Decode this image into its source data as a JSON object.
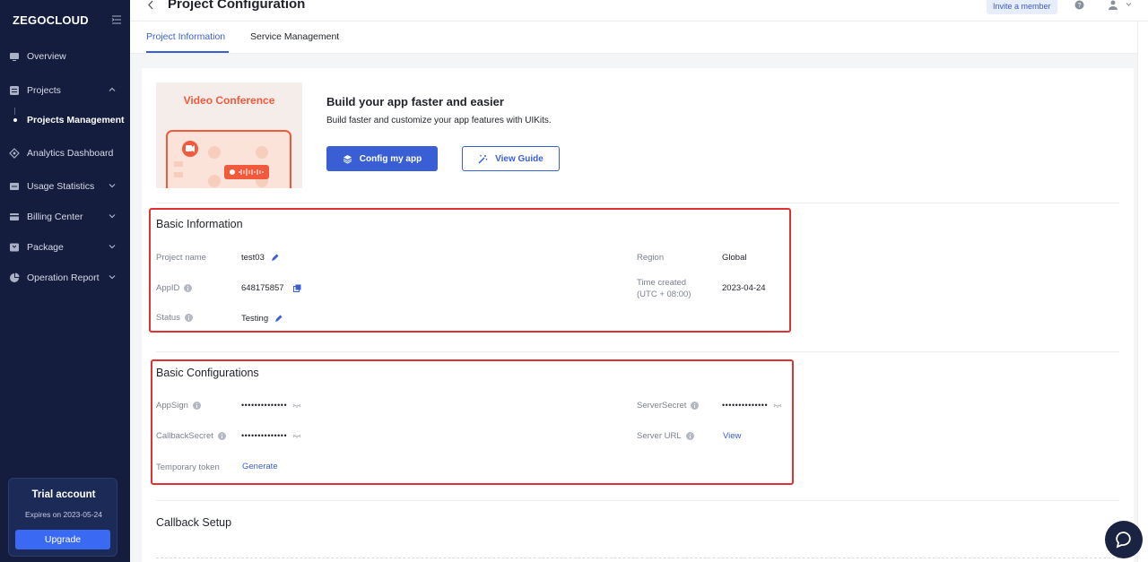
{
  "sidebar": {
    "logo": "ZEGOCLOUD",
    "items": [
      {
        "label": "Overview"
      },
      {
        "label": "Projects"
      },
      {
        "label": "Projects Management"
      },
      {
        "label": "Analytics Dashboard"
      },
      {
        "label": "Usage Statistics"
      },
      {
        "label": "Billing Center"
      },
      {
        "label": "Package"
      },
      {
        "label": "Operation Report"
      }
    ],
    "trial": {
      "title": "Trial account",
      "expires": "Expires on 2023-05-24",
      "upgrade_label": "Upgrade"
    }
  },
  "header": {
    "title": "Project Configuration",
    "invite_label": "Invite a member"
  },
  "tabs": [
    {
      "label": "Project Information",
      "active": true
    },
    {
      "label": "Service Management",
      "active": false
    }
  ],
  "promo": {
    "image_label": "Video Conference",
    "title": "Build your app faster and easier",
    "description": "Build faster and customize your app features with UIKits.",
    "config_label": "Config my app",
    "guide_label": "View Guide"
  },
  "basic_info": {
    "title": "Basic Information",
    "project_name_label": "Project name",
    "project_name": "test03",
    "appid_label": "AppID",
    "appid": "648175857",
    "status_label": "Status",
    "status": "Testing",
    "region_label": "Region",
    "region": "Global",
    "time_created_label_1": "Time created",
    "time_created_label_2": "(UTC + 08:00)",
    "time_created": "2023-04-24"
  },
  "basic_config": {
    "title": "Basic Configurations",
    "appsign_label": "AppSign",
    "appsign": "••••••••••••••",
    "callback_secret_label": "CallbackSecret",
    "callback_secret": "••••••••••••••",
    "temp_token_label": "Temporary token",
    "generate_label": "Generate",
    "server_secret_label": "ServerSecret",
    "server_secret": "••••••••••••••",
    "server_url_label": "Server URL",
    "view_label": "View"
  },
  "callback": {
    "title": "Callback Setup"
  },
  "colors": {
    "sidebar_bg": "#141d3e",
    "accent": "#3a5fd4",
    "highlight_border": "#e03232",
    "promo_accent": "#f15a3c"
  }
}
